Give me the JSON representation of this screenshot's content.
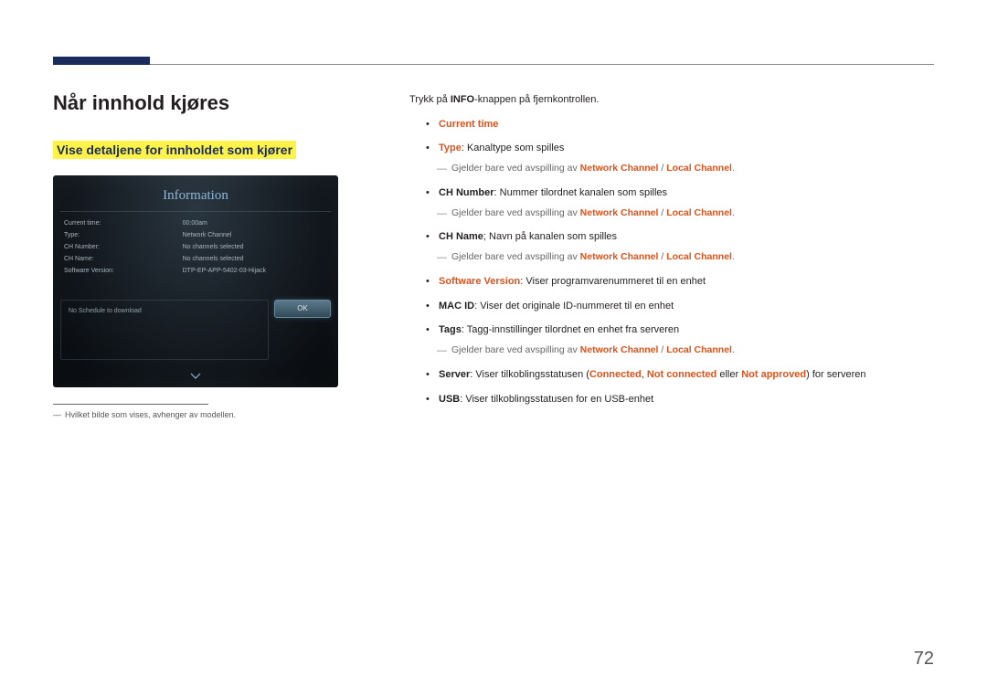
{
  "page_number": "72",
  "h1": "Når innhold kjøres",
  "h2": "Vise detaljene for innholdet som kjører",
  "screenshot": {
    "title": "Information",
    "rows": [
      {
        "label": "Current time:",
        "value": "00:00am"
      },
      {
        "label": "Type:",
        "value": "Network Channel"
      },
      {
        "label": "CH Number:",
        "value": "No channels selected"
      },
      {
        "label": "CH Name:",
        "value": "No channels selected"
      },
      {
        "label": "Software Version:",
        "value": "DTP-EP-APP-5402-03-Hijack"
      }
    ],
    "ok": "OK",
    "schedule_text": "No Schedule to download"
  },
  "footnote": "Hvilket bilde som vises, avhenger av modellen.",
  "intro_a": "Trykk på ",
  "intro_b": "INFO",
  "intro_c": "-knappen på fjernkontrollen.",
  "li1": "Current time",
  "li2": {
    "b": "Type",
    "t": ": Kanaltype som spilles"
  },
  "sub_pre": "Gjelder bare ved avspilling av ",
  "sub_r1": "Network Channel",
  "sub_sep": " / ",
  "sub_r2": "Local Channel",
  "sub_dot": ".",
  "li3": {
    "b": "CH Number",
    "t": ": Nummer tilordnet kanalen som spilles"
  },
  "li4": {
    "b": "CH Name",
    "t": "; Navn på kanalen som spilles"
  },
  "li5": {
    "b": "Software Version",
    "t": ": Viser programvarenummeret til en enhet"
  },
  "li6": {
    "b": "MAC ID",
    "t": ": Viser det originale ID-nummeret til en enhet"
  },
  "li7": {
    "b": "Tags",
    "t": ": Tagg-innstillinger tilordnet en enhet fra serveren"
  },
  "li8": {
    "b": "Server",
    "pre": ": Viser tilkoblingsstatusen (",
    "r1": "Connected",
    "c1": ", ",
    "r2": "Not connected",
    "mid": " eller ",
    "r3": "Not approved",
    "post": ") for serveren"
  },
  "li9": {
    "b": "USB",
    "t": ": Viser tilkoblingsstatusen for en USB-enhet"
  }
}
